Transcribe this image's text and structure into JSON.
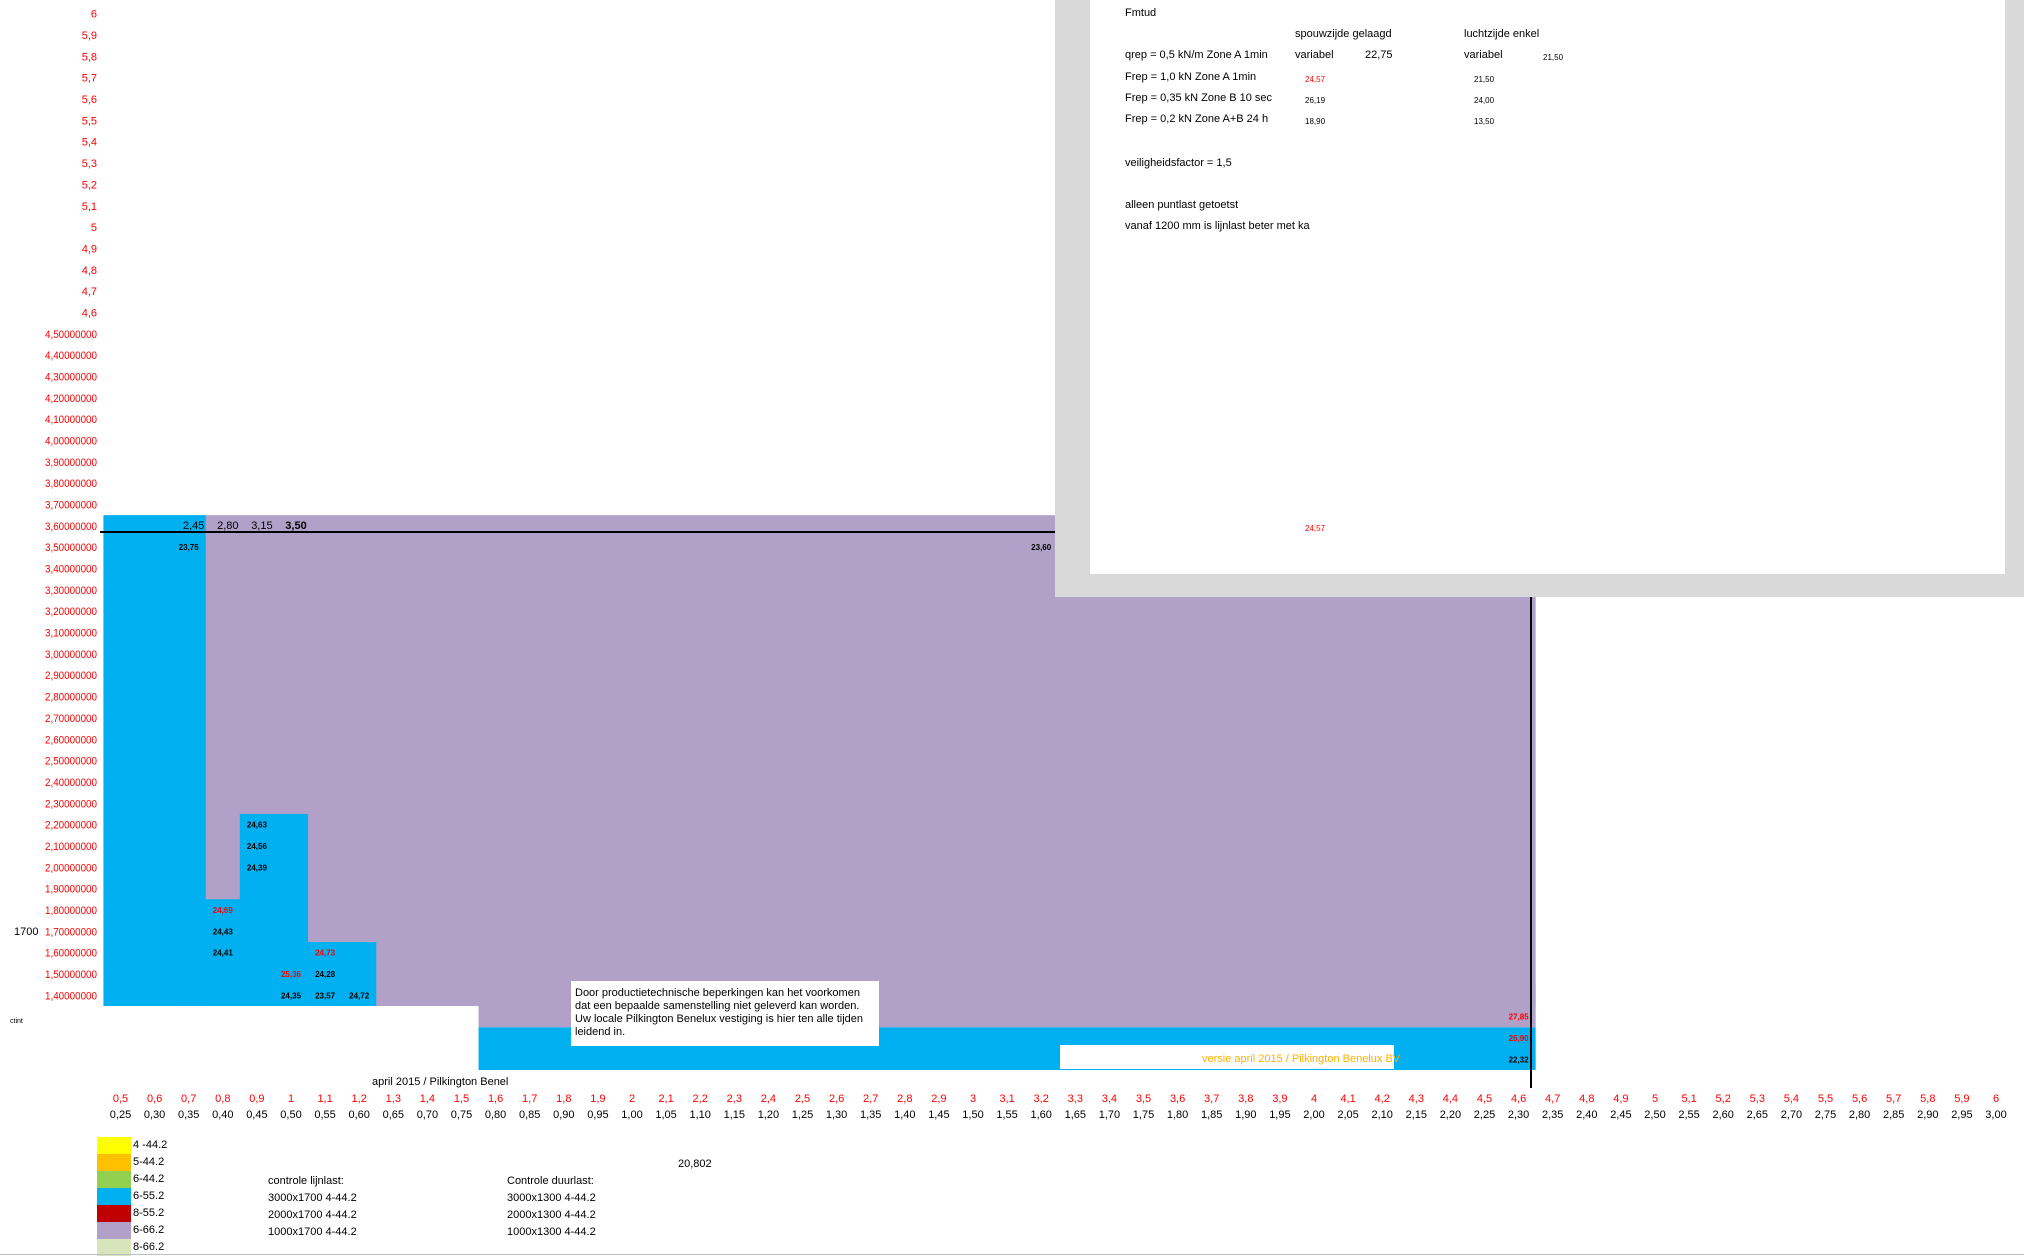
{
  "chart_data": {
    "type": "heatmap",
    "title": "",
    "y_ticks": [
      "6",
      "5,9",
      "5,8",
      "5,7",
      "5,6",
      "5,5",
      "5,4",
      "5,3",
      "5,2",
      "5,1",
      "5",
      "4,9",
      "4,8",
      "4,7",
      "4,6",
      "4,50000000",
      "4,40000000",
      "4,30000000",
      "4,20000000",
      "4,10000000",
      "4,00000000",
      "3,90000000",
      "3,80000000",
      "3,70000000",
      "3,60000000",
      "3,50000000",
      "3,40000000",
      "3,30000000",
      "3,20000000",
      "3,10000000",
      "3,00000000",
      "2,90000000",
      "2,80000000",
      "2,70000000",
      "2,60000000",
      "2,50000000",
      "2,40000000",
      "2,30000000",
      "2,20000000",
      "2,10000000",
      "2,00000000",
      "1,90000000",
      "1,80000000",
      "1,70000000",
      "1,60000000",
      "1,50000000",
      "1,40000000"
    ],
    "x_top_ticks": [
      "0,5",
      "0,6",
      "0,7",
      "0,8",
      "0,9",
      "1",
      "1,1",
      "1,2",
      "1,3",
      "1,4",
      "1,5",
      "1,6",
      "1,7",
      "1,8",
      "1,9",
      "2",
      "2,1",
      "2,2",
      "2,3",
      "2,4",
      "2,5",
      "2,6",
      "2,7",
      "2,8",
      "2,9",
      "3",
      "3,1",
      "3,2",
      "3,3",
      "3,4",
      "3,5",
      "3,6",
      "3,7",
      "3,8",
      "3,9",
      "4",
      "4,1",
      "4,2",
      "4,3",
      "4,4",
      "4,5",
      "4,6",
      "4,7",
      "4,8",
      "4,9",
      "5",
      "5,1",
      "5,2",
      "5,3",
      "5,4",
      "5,5",
      "5,6",
      "5,7",
      "5,8",
      "5,9",
      "6"
    ],
    "x_bottom_ticks": [
      "0,25",
      "0,30",
      "0,35",
      "0,40",
      "0,45",
      "0,50",
      "0,55",
      "0,60",
      "0,65",
      "0,70",
      "0,75",
      "0,80",
      "0,85",
      "0,90",
      "0,95",
      "1,00",
      "1,05",
      "1,10",
      "1,15",
      "1,20",
      "1,25",
      "1,30",
      "1,35",
      "1,40",
      "1,45",
      "1,50",
      "1,55",
      "1,60",
      "1,65",
      "1,70",
      "1,75",
      "1,80",
      "1,85",
      "1,90",
      "1,95",
      "2,00",
      "2,05",
      "2,10",
      "2,15",
      "2,20",
      "2,25",
      "2,30",
      "2,35",
      "2,40",
      "2,45",
      "2,50",
      "2,55",
      "2,60",
      "2,65",
      "2,70",
      "2,75",
      "2,80",
      "2,85",
      "2,90",
      "2,95",
      "3,00"
    ],
    "threshold_labels": [
      {
        "text": "2,45",
        "col": 2
      },
      {
        "text": "2,80",
        "col": 3
      },
      {
        "text": "3,15",
        "col": 4
      },
      {
        "text": "3,50",
        "col": 5,
        "bold": true
      }
    ],
    "regions": [
      {
        "glass": "6-66.2",
        "x_from": 0.5,
        "x_to": 4.6,
        "y_from": 1.4,
        "y_to": 3.6
      },
      {
        "glass": "6-55.2",
        "x_from": 0.5,
        "x_to": 0.7,
        "y_from": 1.4,
        "y_to": 3.6
      },
      {
        "glass": "6-55.2",
        "x_from": 0.7,
        "x_to": 0.9,
        "y_from": 1.4,
        "y_to": 1.8
      },
      {
        "glass": "6-55.2",
        "x_from": 0.9,
        "x_to": 1.0,
        "y_from": 1.5,
        "y_to": 2.2
      },
      {
        "glass": "6-55.2",
        "x_from": 1.0,
        "x_to": 1.1,
        "y_from": 1.4,
        "y_to": 1.5
      },
      {
        "glass": "6-55.2",
        "x_from": 1.1,
        "x_to": 1.2,
        "y_from": 1.4,
        "y_to": 1.6
      },
      {
        "glass": "6-66.2",
        "x_from": 1.6,
        "x_to": 4.6,
        "y_from": 1.4,
        "y_to": 1.3
      },
      {
        "glass": "6-55.2",
        "x_from": 1.6,
        "x_to": 4.6,
        "y_from": 1.2,
        "y_to": 1.1
      }
    ],
    "cell_values": [
      {
        "text": "23,75",
        "x": 0.7,
        "y": 3.5,
        "color": "black"
      },
      {
        "text": "23,60",
        "x": 3.2,
        "y": 3.5,
        "color": "black"
      },
      {
        "text": "24,63",
        "x": 0.9,
        "y": 2.2,
        "color": "black"
      },
      {
        "text": "24,56",
        "x": 0.9,
        "y": 2.1,
        "color": "black"
      },
      {
        "text": "24,39",
        "x": 0.9,
        "y": 2.0,
        "color": "black"
      },
      {
        "text": "24,69",
        "x": 0.8,
        "y": 1.8,
        "color": "red"
      },
      {
        "text": "24,43",
        "x": 0.8,
        "y": 1.7,
        "color": "black"
      },
      {
        "text": "24,41",
        "x": 0.8,
        "y": 1.6,
        "color": "black"
      },
      {
        "text": "24,73",
        "x": 1.1,
        "y": 1.6,
        "color": "red"
      },
      {
        "text": "25,36",
        "x": 1.0,
        "y": 1.5,
        "color": "red"
      },
      {
        "text": "24,28",
        "x": 1.1,
        "y": 1.5,
        "color": "black"
      },
      {
        "text": "24,35",
        "x": 1.0,
        "y": 1.4,
        "color": "black"
      },
      {
        "text": "23,57",
        "x": 1.1,
        "y": 1.4,
        "color": "black"
      },
      {
        "text": "24,72",
        "x": 1.2,
        "y": 1.4,
        "color": "black"
      },
      {
        "text": "27,85",
        "x": 4.6,
        "y": 1.3,
        "color": "red"
      },
      {
        "text": "25,90",
        "x": 4.6,
        "y": 1.2,
        "color": "red"
      },
      {
        "text": "22,32",
        "x": 4.6,
        "y": 1.1,
        "color": "black"
      }
    ],
    "grid": false
  },
  "colors": {
    "yellow": "#ffff00",
    "orange": "#ffc000",
    "green": "#92d050",
    "blue": "#00b0f0",
    "red": "#c00000",
    "purple": "#b1a0c7",
    "pale": "#d8e4bc",
    "gray": "#d9d9d9",
    "label_red": "#ff0000",
    "versie": "#ffb000"
  },
  "side": {
    "label_1700": "1700",
    "clipped_text": "ctint",
    "april_text": "april 2015 / Pilkington Benel"
  },
  "note": {
    "text": "Door productietechnische beperkingen kan het voorkomen dat een bepaalde samenstelling niet geleverd kan worden. Uw locale Pilkington Benelux vestiging is hier ten alle tijden leidend in."
  },
  "versie": "versie april 2015 / Pilkington Benelux BV",
  "panel": {
    "title": "Fmtud",
    "col1_header": "spouwzijde gelaagd",
    "col2_header": "luchtzijde enkel",
    "rows": [
      {
        "label": "qrep = 0,5 kN/m Zone A 1min",
        "v1": "variabel",
        "v1b": "22,75",
        "v2": "variabel",
        "v2b": "21,50"
      },
      {
        "label": "Frep = 1,0 kN Zone A 1min",
        "v1": "24,57",
        "v1_red": true,
        "v2": "21,50"
      },
      {
        "label": "Frep = 0,35 kN Zone B 10 sec",
        "v1": "26,19",
        "v2": "24,00"
      },
      {
        "label": "Frep = 0,2 kN Zone A+B 24 h",
        "v1": "18,90",
        "v2": "13,50"
      }
    ],
    "safety": "veiligheidsfactor = 1,5",
    "line1": "alleen puntlast getoetst",
    "line2": "vanaf 1200 mm is lijnlast beter met ka",
    "bottom_red": "24,57"
  },
  "legend": {
    "items": [
      {
        "label": "4 -44.2",
        "color": "#ffff00"
      },
      {
        "label": "5-44.2",
        "color": "#ffc000"
      },
      {
        "label": "6-44.2",
        "color": "#92d050"
      },
      {
        "label": "6-55.2",
        "color": "#00b0f0"
      },
      {
        "label": "8-55.2",
        "color": "#c00000"
      },
      {
        "label": "6-66.2",
        "color": "#b1a0c7"
      },
      {
        "label": "8-66.2",
        "color": "#d8e4bc"
      }
    ]
  },
  "bottom": {
    "value": "20,802",
    "lijnlast_title": "controle lijnlast:",
    "lijnlast": [
      "3000x1700  4-44.2",
      "2000x1700 4-44.2",
      "1000x1700 4-44.2"
    ],
    "duurlast_title": "Controle duurlast:",
    "duurlast": [
      "3000x1300 4-44.2",
      "2000x1300 4-44.2",
      "1000x1300 4-44.2"
    ]
  }
}
